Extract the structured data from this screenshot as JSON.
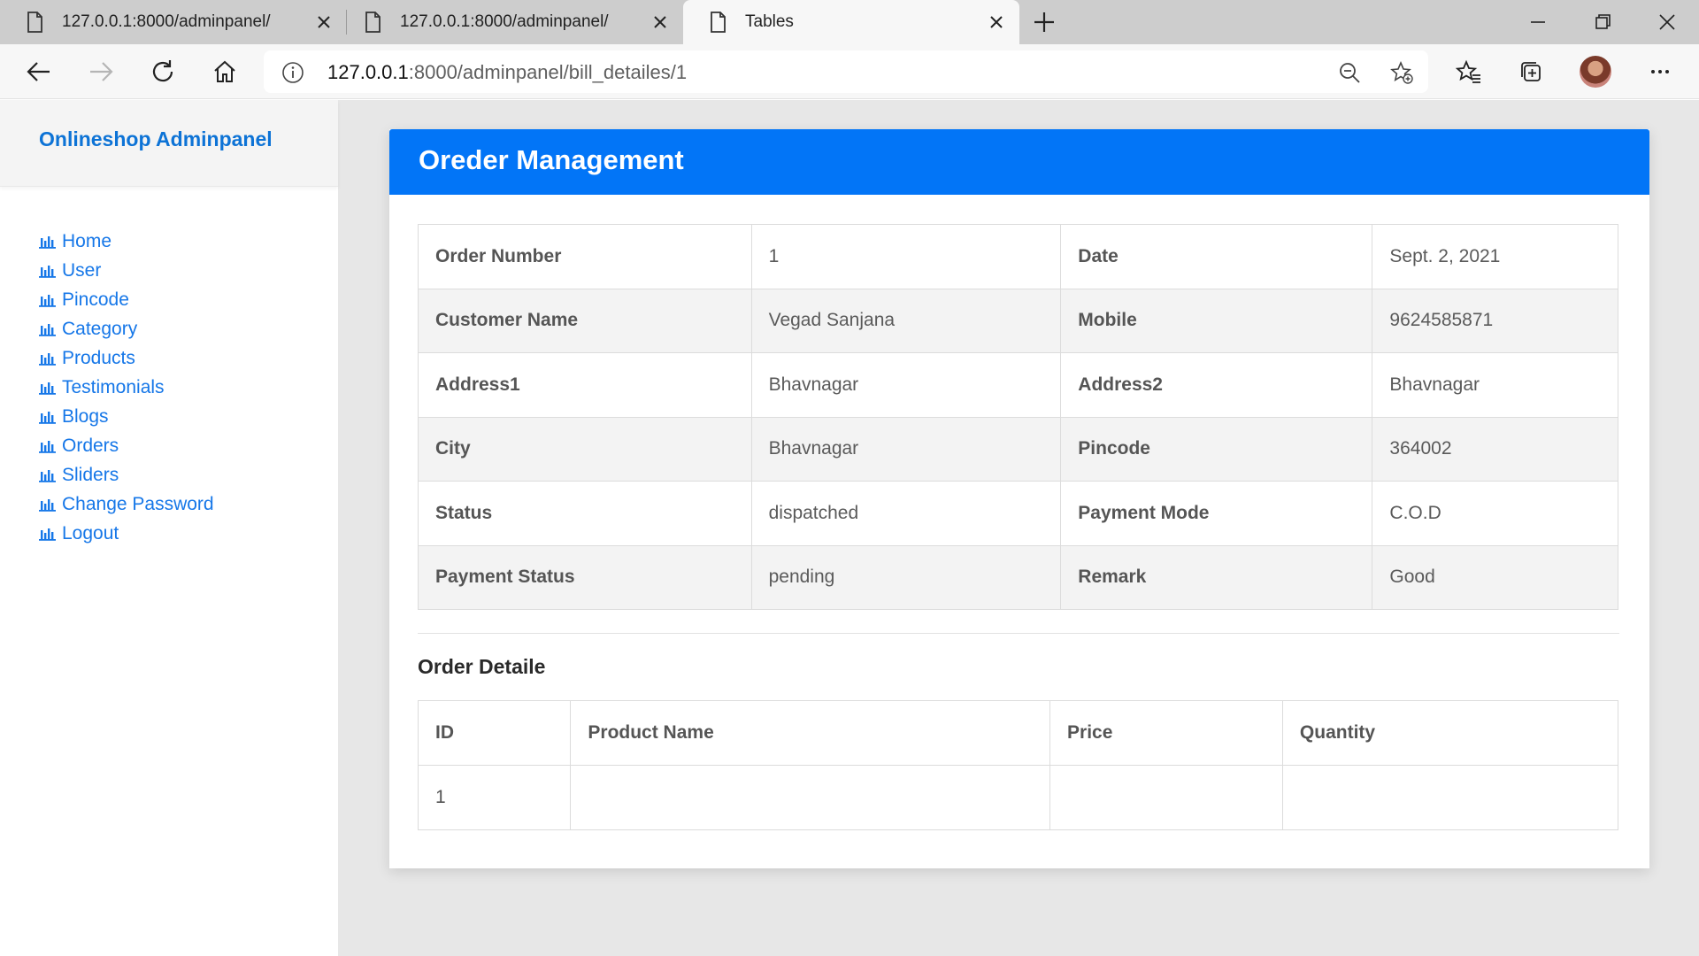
{
  "browser": {
    "tabs": [
      {
        "title": "127.0.0.1:8000/adminpanel/",
        "active": false
      },
      {
        "title": "127.0.0.1:8000/adminpanel/",
        "active": false
      },
      {
        "title": "Tables",
        "active": true
      }
    ],
    "address": {
      "host": "127.0.0.1",
      "path": ":8000/adminpanel/bill_detailes/1"
    },
    "icons": [
      "back-icon",
      "forward-icon",
      "refresh-icon",
      "home-icon",
      "info-icon",
      "zoom-out-icon",
      "add-favorite-icon",
      "favorites-icon",
      "collections-icon",
      "profile-avatar",
      "more-icon"
    ]
  },
  "sidebar": {
    "brand": "Onlineshop Adminpanel",
    "items": [
      {
        "label": "Home"
      },
      {
        "label": "User"
      },
      {
        "label": "Pincode"
      },
      {
        "label": "Category"
      },
      {
        "label": "Products"
      },
      {
        "label": "Testimonials"
      },
      {
        "label": "Blogs"
      },
      {
        "label": "Orders"
      },
      {
        "label": "Sliders"
      },
      {
        "label": "Change Password"
      },
      {
        "label": "Logout"
      }
    ]
  },
  "card": {
    "title": "Oreder Management",
    "info": [
      {
        "l1": "Order Number",
        "v1": "1",
        "l2": "Date",
        "v2": "Sept. 2, 2021"
      },
      {
        "l1": "Customer Name",
        "v1": "Vegad Sanjana",
        "l2": "Mobile",
        "v2": "9624585871"
      },
      {
        "l1": "Address1",
        "v1": "Bhavnagar",
        "l2": "Address2",
        "v2": "Bhavnagar"
      },
      {
        "l1": "City",
        "v1": "Bhavnagar",
        "l2": "Pincode",
        "v2": "364002"
      },
      {
        "l1": "Status",
        "v1": "dispatched",
        "l2": "Payment Mode",
        "v2": "C.O.D"
      },
      {
        "l1": "Payment Status",
        "v1": "pending",
        "l2": "Remark",
        "v2": "Good"
      }
    ],
    "detail_title": "Order Detaile",
    "detail_columns": [
      "ID",
      "Product Name",
      "Price",
      "Quantity"
    ],
    "detail_rows": [
      {
        "id": "1",
        "product": "",
        "price": "",
        "qty": ""
      }
    ]
  },
  "colors": {
    "accent": "#0275f7",
    "link": "#1677e8",
    "brand": "#0d73d6"
  }
}
